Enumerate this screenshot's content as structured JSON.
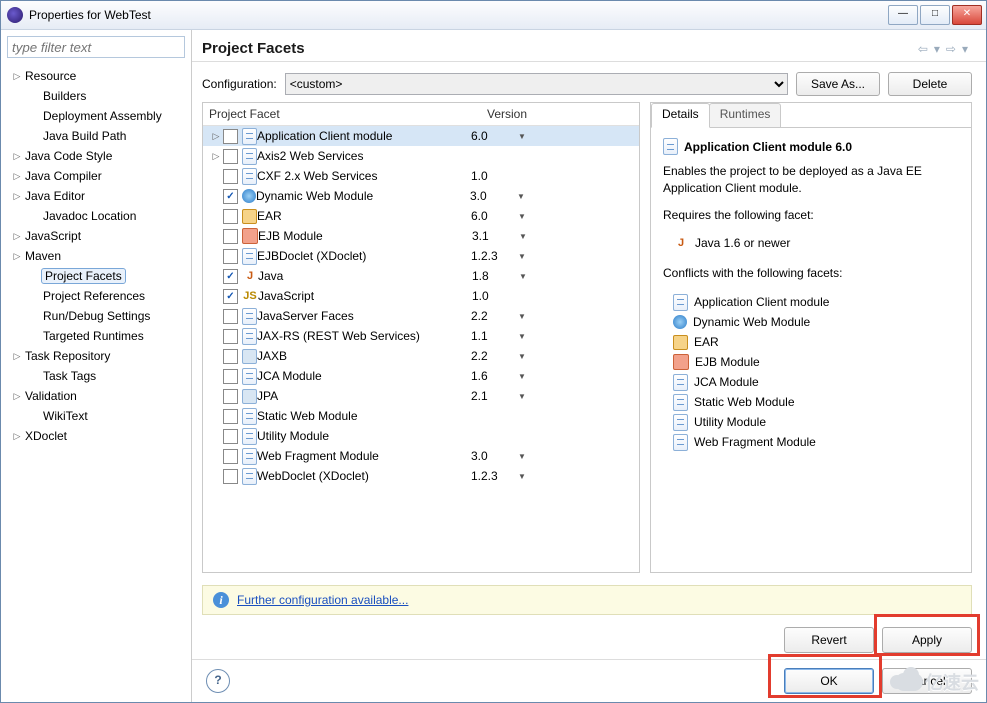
{
  "window": {
    "title": "Properties for WebTest"
  },
  "sidebar": {
    "filter_placeholder": "type filter text",
    "items": [
      {
        "label": "Resource",
        "expandable": true,
        "level": 0
      },
      {
        "label": "Builders",
        "level": 1
      },
      {
        "label": "Deployment Assembly",
        "level": 1
      },
      {
        "label": "Java Build Path",
        "level": 1
      },
      {
        "label": "Java Code Style",
        "expandable": true,
        "level": 0
      },
      {
        "label": "Java Compiler",
        "expandable": true,
        "level": 0
      },
      {
        "label": "Java Editor",
        "expandable": true,
        "level": 0
      },
      {
        "label": "Javadoc Location",
        "level": 1
      },
      {
        "label": "JavaScript",
        "expandable": true,
        "level": 0
      },
      {
        "label": "Maven",
        "expandable": true,
        "level": 0
      },
      {
        "label": "Project Facets",
        "level": 1,
        "selected": true
      },
      {
        "label": "Project References",
        "level": 1
      },
      {
        "label": "Run/Debug Settings",
        "level": 1
      },
      {
        "label": "Targeted Runtimes",
        "level": 1
      },
      {
        "label": "Task Repository",
        "expandable": true,
        "level": 0
      },
      {
        "label": "Task Tags",
        "level": 1
      },
      {
        "label": "Validation",
        "expandable": true,
        "level": 0
      },
      {
        "label": "WikiText",
        "level": 1
      },
      {
        "label": "XDoclet",
        "expandable": true,
        "level": 0
      }
    ]
  },
  "main": {
    "heading": "Project Facets",
    "config_label": "Configuration:",
    "config_value": "<custom>",
    "save_as": "Save As...",
    "delete": "Delete",
    "columns": {
      "facet": "Project Facet",
      "version": "Version"
    },
    "facets": [
      {
        "name": "Application Client module",
        "ver": "6.0",
        "dd": true,
        "expand": "▷",
        "icon": "page",
        "selected": true
      },
      {
        "name": "Axis2 Web Services",
        "ver": "",
        "dd": false,
        "expand": "▷",
        "icon": "page"
      },
      {
        "name": "CXF 2.x Web Services",
        "ver": "1.0",
        "dd": false,
        "icon": "page"
      },
      {
        "name": "Dynamic Web Module",
        "ver": "3.0",
        "dd": true,
        "icon": "globe",
        "checked": true
      },
      {
        "name": "EAR",
        "ver": "6.0",
        "dd": true,
        "icon": "ear"
      },
      {
        "name": "EJB Module",
        "ver": "3.1",
        "dd": true,
        "icon": "ejb"
      },
      {
        "name": "EJBDoclet (XDoclet)",
        "ver": "1.2.3",
        "dd": true,
        "icon": "page"
      },
      {
        "name": "Java",
        "ver": "1.8",
        "dd": true,
        "icon": "java",
        "checked": true
      },
      {
        "name": "JavaScript",
        "ver": "1.0",
        "dd": false,
        "icon": "js",
        "checked": true
      },
      {
        "name": "JavaServer Faces",
        "ver": "2.2",
        "dd": true,
        "icon": "page"
      },
      {
        "name": "JAX-RS (REST Web Services)",
        "ver": "1.1",
        "dd": true,
        "icon": "page"
      },
      {
        "name": "JAXB",
        "ver": "2.2",
        "dd": true,
        "icon": "generic"
      },
      {
        "name": "JCA Module",
        "ver": "1.6",
        "dd": true,
        "icon": "page"
      },
      {
        "name": "JPA",
        "ver": "2.1",
        "dd": true,
        "icon": "generic"
      },
      {
        "name": "Static Web Module",
        "ver": "",
        "dd": false,
        "icon": "page"
      },
      {
        "name": "Utility Module",
        "ver": "",
        "dd": false,
        "icon": "page"
      },
      {
        "name": "Web Fragment Module",
        "ver": "3.0",
        "dd": true,
        "icon": "page"
      },
      {
        "name": "WebDoclet (XDoclet)",
        "ver": "1.2.3",
        "dd": true,
        "icon": "page"
      }
    ],
    "details": {
      "tab_details": "Details",
      "tab_runtimes": "Runtimes",
      "title": "Application Client module 6.0",
      "desc": "Enables the project to be deployed as a Java EE Application Client module.",
      "requires_label": "Requires the following facet:",
      "requires": [
        {
          "label": "Java 1.6 or newer",
          "icon": "java"
        }
      ],
      "conflicts_label": "Conflicts with the following facets:",
      "conflicts": [
        {
          "label": "Application Client module",
          "icon": "page"
        },
        {
          "label": "Dynamic Web Module",
          "icon": "globe"
        },
        {
          "label": "EAR",
          "icon": "ear"
        },
        {
          "label": "EJB Module",
          "icon": "ejb"
        },
        {
          "label": "JCA Module",
          "icon": "page"
        },
        {
          "label": "Static Web Module",
          "icon": "page"
        },
        {
          "label": "Utility Module",
          "icon": "page"
        },
        {
          "label": "Web Fragment Module",
          "icon": "page"
        }
      ]
    },
    "info_link": "Further configuration available...",
    "revert": "Revert",
    "apply": "Apply",
    "ok": "OK",
    "cancel": "Cancel"
  },
  "watermark": "亿速云"
}
